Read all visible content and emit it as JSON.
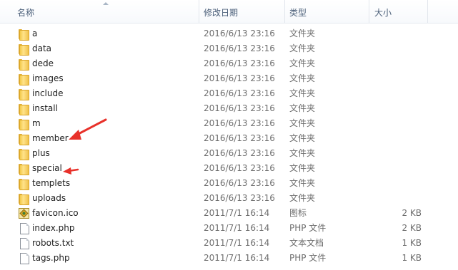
{
  "columns": {
    "name": "名称",
    "date": "修改日期",
    "type": "类型",
    "size": "大小"
  },
  "files": [
    {
      "name": "a",
      "date": "2016/6/13 23:16",
      "type": "文件夹",
      "size": "",
      "icon": "folder-icon"
    },
    {
      "name": "data",
      "date": "2016/6/13 23:16",
      "type": "文件夹",
      "size": "",
      "icon": "folder-icon"
    },
    {
      "name": "dede",
      "date": "2016/6/13 23:16",
      "type": "文件夹",
      "size": "",
      "icon": "folder-icon"
    },
    {
      "name": "images",
      "date": "2016/6/13 23:16",
      "type": "文件夹",
      "size": "",
      "icon": "folder-icon"
    },
    {
      "name": "include",
      "date": "2016/6/13 23:16",
      "type": "文件夹",
      "size": "",
      "icon": "folder-icon"
    },
    {
      "name": "install",
      "date": "2016/6/13 23:16",
      "type": "文件夹",
      "size": "",
      "icon": "folder-icon"
    },
    {
      "name": "m",
      "date": "2016/6/13 23:16",
      "type": "文件夹",
      "size": "",
      "icon": "folder-icon"
    },
    {
      "name": "member",
      "date": "2016/6/13 23:16",
      "type": "文件夹",
      "size": "",
      "icon": "folder-icon"
    },
    {
      "name": "plus",
      "date": "2016/6/13 23:16",
      "type": "文件夹",
      "size": "",
      "icon": "folder-icon"
    },
    {
      "name": "special",
      "date": "2016/6/13 23:16",
      "type": "文件夹",
      "size": "",
      "icon": "folder-icon"
    },
    {
      "name": "templets",
      "date": "2016/6/13 23:16",
      "type": "文件夹",
      "size": "",
      "icon": "folder-icon"
    },
    {
      "name": "uploads",
      "date": "2016/6/13 23:16",
      "type": "文件夹",
      "size": "",
      "icon": "folder-icon"
    },
    {
      "name": "favicon.ico",
      "date": "2011/7/1 16:14",
      "type": "图标",
      "size": "2 KB",
      "icon": "ico-file-icon"
    },
    {
      "name": "index.php",
      "date": "2011/7/1 16:14",
      "type": "PHP 文件",
      "size": "2 KB",
      "icon": "file-icon"
    },
    {
      "name": "robots.txt",
      "date": "2011/7/1 16:14",
      "type": "文本文档",
      "size": "1 KB",
      "icon": "file-icon"
    },
    {
      "name": "tags.php",
      "date": "2011/7/1 16:14",
      "type": "PHP 文件",
      "size": "1 KB",
      "icon": "file-icon"
    }
  ],
  "annotation_color": "#e8312a",
  "folder_color": "#f2c94a"
}
